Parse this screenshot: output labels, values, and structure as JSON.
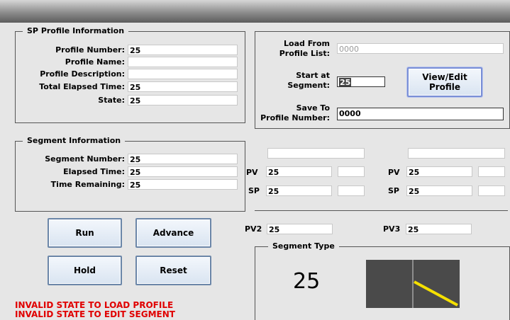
{
  "sp_profile": {
    "title": "SP Profile Information",
    "profile_number_label": "Profile Number:",
    "profile_number": "25",
    "profile_name_label": "Profile Name:",
    "profile_name": "",
    "profile_description_label": "Profile Description:",
    "profile_description": "",
    "total_elapsed_label": "Total Elapsed Time:",
    "total_elapsed": "25",
    "state_label": "State:",
    "state": "25"
  },
  "profile_ops": {
    "load_label_1": "Load From",
    "load_label_2": "Profile List:",
    "load_value": "0000",
    "start_label_1": "Start at",
    "start_label_2": "Segment:",
    "start_value": "25",
    "save_label_1": "Save To",
    "save_label_2": "Profile Number:",
    "save_value": "0000",
    "view_edit_label_1": "View/Edit",
    "view_edit_label_2": "Profile"
  },
  "segment": {
    "title": "Segment Information",
    "segment_number_label": "Segment Number:",
    "segment_number": "25",
    "elapsed_label": "Elapsed Time:",
    "elapsed": "25",
    "remaining_label": "Time Remaining:",
    "remaining": "25"
  },
  "loops": {
    "left": {
      "pv_label": "PV",
      "pv": "25",
      "sp_label": "SP",
      "sp": "25"
    },
    "right": {
      "pv_label": "PV",
      "pv": "25",
      "sp_label": "SP",
      "sp": "25"
    },
    "pv2_label": "PV2",
    "pv2": "25",
    "pv3_label": "PV3",
    "pv3": "25"
  },
  "buttons": {
    "run": "Run",
    "advance": "Advance",
    "hold": "Hold",
    "reset": "Reset"
  },
  "segment_type": {
    "title": "Segment Type",
    "value": "25"
  },
  "warnings": [
    "INVALID STATE TO LOAD PROFILE",
    "INVALID STATE TO EDIT SEGMENT"
  ],
  "colors": {
    "warning": "#e00000",
    "ramp_line": "#f5e000",
    "graph_bg": "#4a4a4a",
    "button_border": "#6b86a8"
  },
  "icons": {
    "segment_graph": "ramp-down-graph"
  }
}
